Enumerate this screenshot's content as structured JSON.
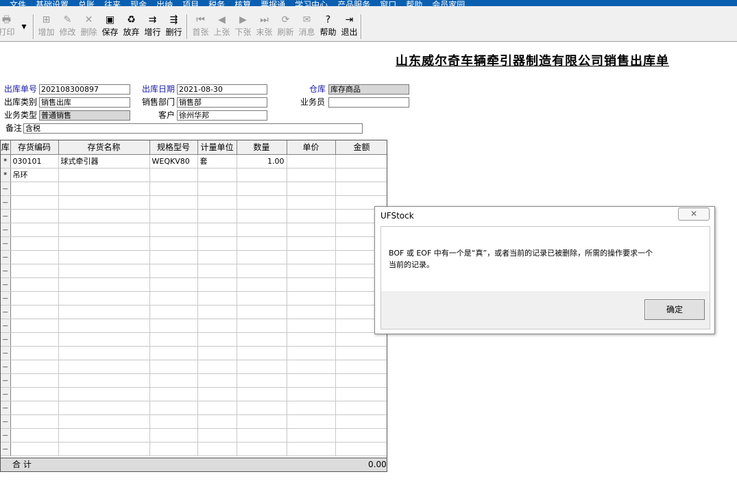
{
  "menu": [
    "文件",
    "基础设置",
    "总账",
    "往来",
    "现金",
    "出纳",
    "项目",
    "税务",
    "核算",
    "票据通",
    "学习中心",
    "产品服务",
    "窗口",
    "帮助",
    "会员家园"
  ],
  "toolbar": {
    "print": "打印",
    "add": "增加",
    "edit": "修改",
    "delete": "删除",
    "save": "保存",
    "discard": "放弃",
    "add_row": "增行",
    "del_row": "删行",
    "first": "首张",
    "prev": "上张",
    "next": "下张",
    "last": "末张",
    "refresh": "刷新",
    "message": "消息",
    "help": "帮助",
    "exit": "退出"
  },
  "form": {
    "title": "山东威尔奇车辆牵引器制造有限公司销售出库单",
    "doc_no_label": "出库单号",
    "doc_no": "202108300897",
    "date_label": "出库日期",
    "date": "2021-08-30",
    "warehouse_label": "仓库",
    "warehouse": "库存商品",
    "out_type_label": "出库类别",
    "out_type": "销售出库",
    "dept_label": "销售部门",
    "dept": "销售部",
    "salesman_label": "业务员",
    "salesman": "",
    "biz_type_label": "业务类型",
    "biz_type": "普通销售",
    "customer_label": "客户",
    "customer": "徐州华邦",
    "note_label": "备注",
    "note": "含税"
  },
  "grid": {
    "col_partial": "库",
    "columns": [
      "存货编码",
      "存货名称",
      "规格型号",
      "计量单位",
      "数量",
      "单价",
      "金额"
    ],
    "rows": [
      {
        "marker": "*",
        "code": "030101",
        "name": "球式牵引器",
        "spec": "WEQKV80",
        "unit": "套",
        "qty": "1.00",
        "price": "",
        "amount": ""
      },
      {
        "marker": "*",
        "code": "吊环",
        "name": "",
        "spec": "",
        "unit": "",
        "qty": "",
        "price": "",
        "amount": ""
      }
    ],
    "total_label": "合 计",
    "total_amount": "0.00"
  },
  "dialog": {
    "title": "UFStock",
    "close": "✕",
    "message_line1": "BOF 或 EOF 中有一个是“真”，或者当前的记录已被删除，所需的操作要求一个",
    "message_line2": "当前的记录。",
    "ok": "确定"
  }
}
